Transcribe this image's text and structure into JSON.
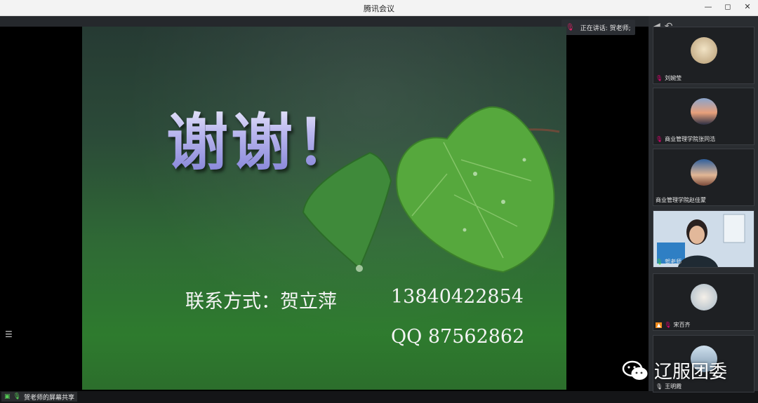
{
  "window": {
    "title": "腾讯会议",
    "controls": [
      "—",
      "◻",
      "✕"
    ]
  },
  "speaking": {
    "label": "正在讲话: 贺老师;"
  },
  "slide": {
    "heading": "谢谢！",
    "contact_label": "联系方式：贺立萍",
    "phone": "13840422854",
    "qq": "QQ  87562862"
  },
  "screen_share": {
    "label": "贺老师的屏幕共享"
  },
  "participants": [
    {
      "name": "刘婉莹",
      "avatar": "cat-avatar",
      "top_px_hint": "t1"
    },
    {
      "name": "商业管理学院张同浩",
      "avatar": "sunset-avatar"
    },
    {
      "name": "商业管理学院赵佳蒙",
      "avatar": "couple-avatar"
    },
    {
      "name": "贺老师",
      "avatar": "video-feed"
    },
    {
      "name": "宋百齐",
      "avatar": "cat-avatar"
    },
    {
      "name": "王明霞",
      "avatar": "person-avatar"
    }
  ],
  "watermark": {
    "text": "辽服团委"
  }
}
